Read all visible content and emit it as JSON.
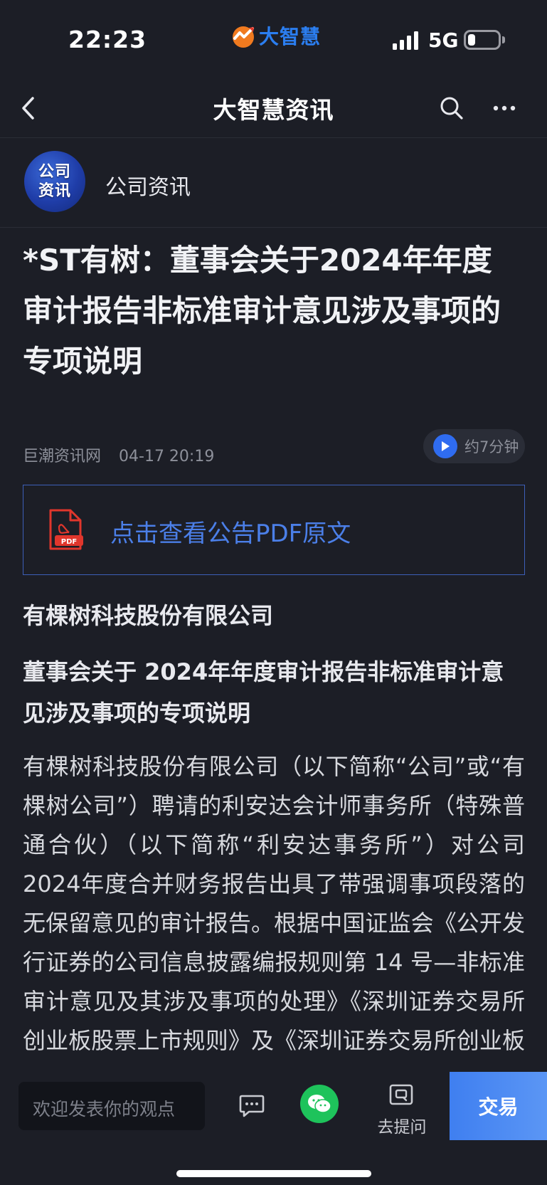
{
  "status_bar": {
    "time": "22:23",
    "brand": "大智慧",
    "network": "5G"
  },
  "nav": {
    "title": "大智慧资讯",
    "icons": [
      "back-arrow-icon",
      "search-icon",
      "more-icon"
    ]
  },
  "channel": {
    "avatar_line1": "公司",
    "avatar_line2": "资讯",
    "name": "公司资讯"
  },
  "article": {
    "title": "*ST有树：董事会关于2024年年度审计报告非标准审计意见涉及事项的专项说明",
    "source": "巨潮资讯网",
    "date": "04-17 20:19",
    "audio_duration": "约7分钟",
    "pdf_link": "点击查看公告PDF原文",
    "company_heading": "有棵树科技股份有限公司",
    "sub_heading": "董事会关于 2024年年度审计报告非标准审计意见涉及事项的专项说明",
    "body": "有棵树科技股份有限公司（以下简称“公司”或“有棵树公司”）聘请的利安达会计师事务所（特殊普通合伙）（以下简称“利安达事务所”）对公司 2024年度合并财务报告出具了带强调事项段落的无保留意见的审计报告。根据中国证监会《公开发行证券的公司信息披露编报规则第 14 号—非标准审计意见及其涉及事项的处理》《深圳证券交易所创业板股票上市规则》及《深圳证券交易所创业板上市公司自律监管指引》"
  },
  "bottom_bar": {
    "comment_placeholder": "欢迎发表你的观点",
    "ask_label": "去提问",
    "trade_label": "交易"
  },
  "colors": {
    "background": "#1c1e26",
    "accent_blue": "#2f6cf0",
    "link_blue": "#4b7fe8",
    "wechat_green": "#1ec35b"
  }
}
